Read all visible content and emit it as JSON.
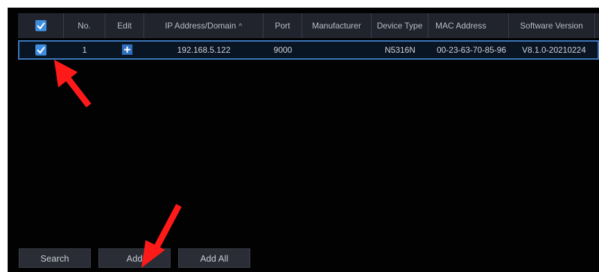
{
  "table": {
    "columns": {
      "no": "No.",
      "edit": "Edit",
      "ip": "IP Address/Domain",
      "port": "Port",
      "manufacturer": "Manufacturer",
      "device_type": "Device Type",
      "mac": "MAC Address",
      "software": "Software Version"
    },
    "sort_icon": "chevron-up-icon",
    "rows": [
      {
        "checked": true,
        "no": "1",
        "edit_icon": "plus-icon",
        "ip": "192.168.5.122",
        "port": "9000",
        "manufacturer": "",
        "device_type": "N5316N",
        "mac": "00-23-63-70-85-96",
        "software": "V8.1.0-20210224"
      }
    ]
  },
  "buttons": {
    "search": "Search",
    "add": "Add",
    "add_all": "Add All"
  },
  "colors": {
    "accent": "#3d8ee0",
    "selected_row_border": "#3d7cc4",
    "annotation_arrow": "#ff1a1a"
  }
}
